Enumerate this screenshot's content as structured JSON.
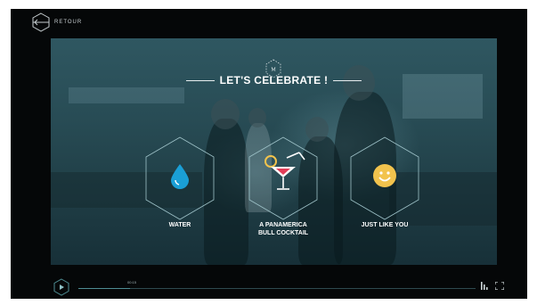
{
  "header": {
    "back_label": "RETOUR"
  },
  "overlay": {
    "title": "LET'S CELEBRATE !"
  },
  "choices": [
    {
      "label": "WATER",
      "icon": "water-drop-icon"
    },
    {
      "label": "A PANAMERICA\nBULL COCKTAIL",
      "icon": "cocktail-glass-icon"
    },
    {
      "label": "JUST LIKE YOU",
      "icon": "smiley-icon"
    }
  ],
  "player": {
    "time": "00:15",
    "progress": 0.13
  },
  "colors": {
    "accent": "#1a9fd6",
    "smiley": "#f2c34d",
    "cocktail": "#e23c57",
    "backdrop": "#284c55"
  }
}
